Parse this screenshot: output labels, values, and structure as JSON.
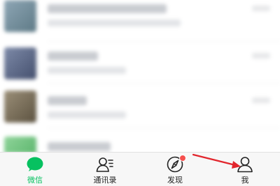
{
  "colors": {
    "accent": "#07c160",
    "badge": "#f5504e",
    "arrow": "#e2262d"
  },
  "tabbar": {
    "tabs": [
      {
        "label": "微信",
        "icon": "chat-bubble-icon",
        "active": true
      },
      {
        "label": "通讯录",
        "icon": "contacts-icon",
        "active": false
      },
      {
        "label": "发现",
        "icon": "compass-icon",
        "active": false,
        "badge": "dot"
      },
      {
        "label": "我",
        "icon": "person-icon",
        "active": false
      }
    ]
  },
  "annotation": {
    "type": "red-arrow",
    "pointing_to": "我"
  }
}
